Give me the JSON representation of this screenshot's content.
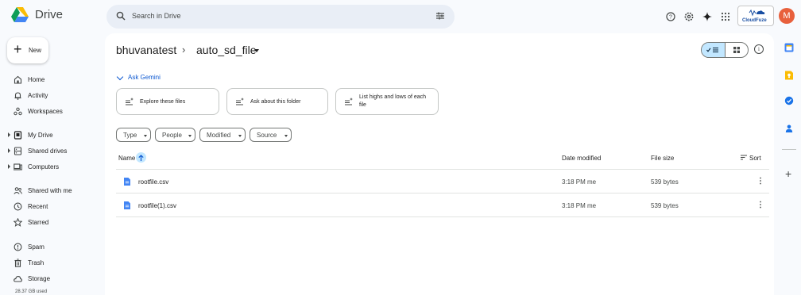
{
  "app": {
    "name": "Drive"
  },
  "search": {
    "placeholder": "Search in Drive"
  },
  "account": {
    "initial": "M",
    "addon_label": "CloudFuze"
  },
  "sidebar": {
    "new_label": "New",
    "items": [
      {
        "label": "Home",
        "icon": "home-icon"
      },
      {
        "label": "Activity",
        "icon": "bell-icon"
      },
      {
        "label": "Workspaces",
        "icon": "workspaces-icon"
      },
      {
        "label": "My Drive",
        "icon": "my-drive-icon"
      },
      {
        "label": "Shared drives",
        "icon": "shared-drives-icon"
      },
      {
        "label": "Computers",
        "icon": "computers-icon"
      },
      {
        "label": "Shared with me",
        "icon": "shared-with-me-icon"
      },
      {
        "label": "Recent",
        "icon": "clock-icon"
      },
      {
        "label": "Starred",
        "icon": "star-icon"
      },
      {
        "label": "Spam",
        "icon": "spam-icon"
      },
      {
        "label": "Trash",
        "icon": "trash-icon"
      },
      {
        "label": "Storage",
        "icon": "cloud-icon"
      }
    ],
    "storage_used": "28.37 GB used"
  },
  "breadcrumb": {
    "root": "bhuvanatest",
    "separator": "›",
    "current": "auto_sd_file"
  },
  "gemini": {
    "toggle_label": "Ask Gemini",
    "chips": [
      "Explore these files",
      "Ask about this folder",
      "List highs and lows of each file"
    ]
  },
  "filters": [
    "Type",
    "People",
    "Modified",
    "Source"
  ],
  "table": {
    "columns": {
      "name": "Name",
      "date": "Date modified",
      "size": "File size",
      "sort": "Sort"
    },
    "rows": [
      {
        "name": "rootfile.csv",
        "date": "3:18 PM me",
        "size": "539 bytes"
      },
      {
        "name": "rootfile(1).csv",
        "date": "3:18 PM me",
        "size": "539 bytes"
      }
    ]
  },
  "colors": {
    "accent": "#0b57d0",
    "selected": "#c2e7ff",
    "avatar": "#e8603c",
    "doc_icon": "#4285f4"
  }
}
